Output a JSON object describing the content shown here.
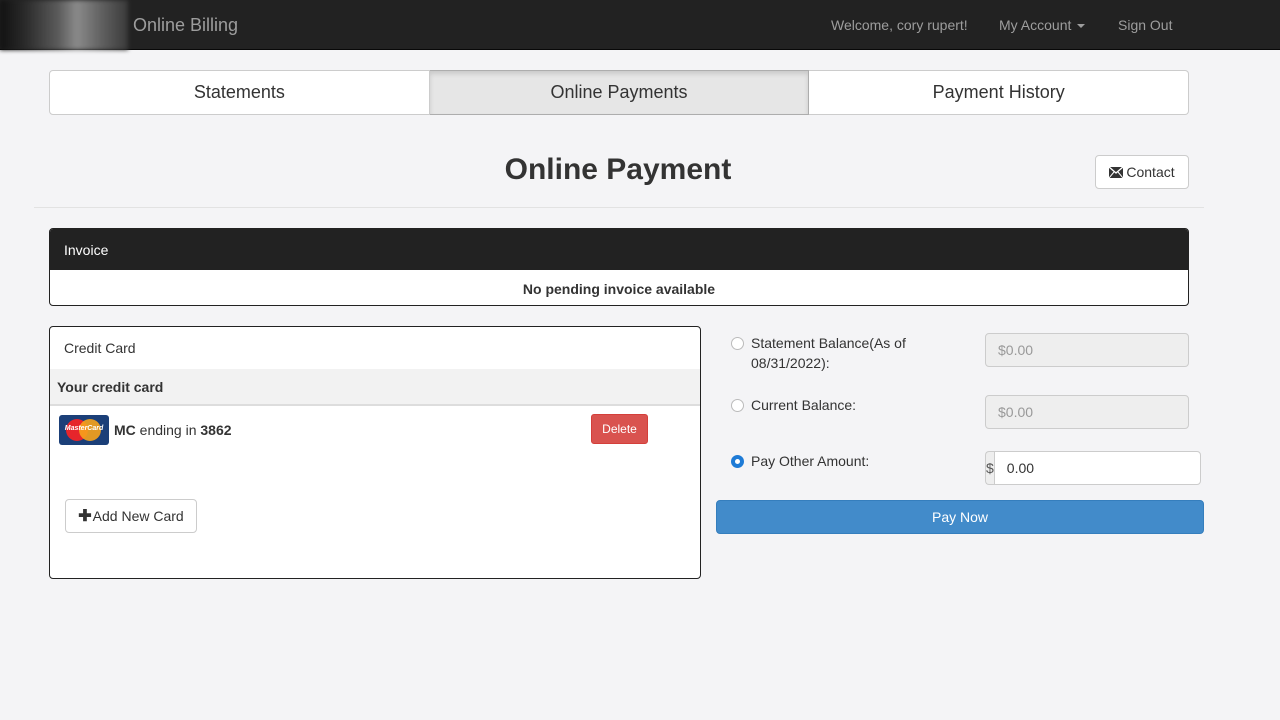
{
  "navbar": {
    "brand": "Online Billing",
    "welcome": "Welcome, cory rupert!",
    "my_account": "My Account",
    "sign_out": "Sign Out"
  },
  "tabs": [
    {
      "label": "Statements"
    },
    {
      "label": "Online Payments"
    },
    {
      "label": "Payment History"
    }
  ],
  "page": {
    "title": "Online Payment",
    "contact_label": "Contact"
  },
  "invoice": {
    "heading": "Invoice",
    "message": "No pending invoice available"
  },
  "credit_card": {
    "heading": "Credit Card",
    "subheading": "Your credit card",
    "card": {
      "brand_logo_text": "MasterCard",
      "type": "MC",
      "ending_text": "ending in",
      "last4": "3862"
    },
    "delete_label": "Delete",
    "add_new_label": "Add New Card"
  },
  "payment": {
    "statement_balance_label": "Statement Balance(As of 08/31/2022):",
    "statement_balance_value": "$0.00",
    "current_balance_label": "Current Balance:",
    "current_balance_value": "$0.00",
    "other_amount_label": "Pay Other Amount:",
    "currency_symbol": "$",
    "other_amount_value": "0.00",
    "pay_now_label": "Pay Now",
    "selected_option": "other_amount"
  }
}
